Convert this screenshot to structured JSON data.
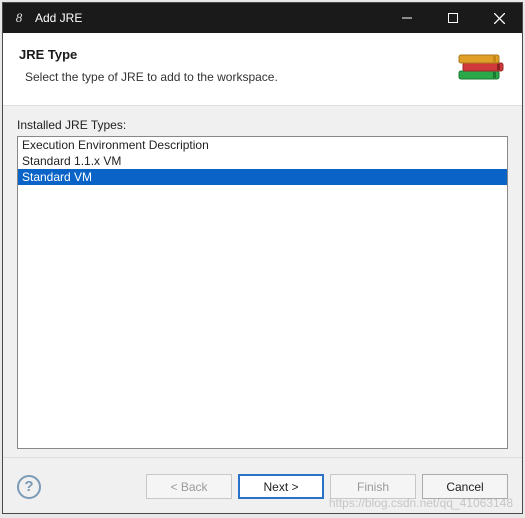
{
  "titlebar": {
    "icon_glyph": "8",
    "title": "Add JRE"
  },
  "header": {
    "title": "JRE Type",
    "subtitle": "Select the type of JRE to add to the workspace."
  },
  "list": {
    "label": "Installed JRE Types:",
    "items": [
      {
        "label": "Execution Environment Description",
        "selected": false
      },
      {
        "label": "Standard 1.1.x VM",
        "selected": false
      },
      {
        "label": "Standard VM",
        "selected": true
      }
    ]
  },
  "buttons": {
    "back": "< Back",
    "next": "Next >",
    "finish": "Finish",
    "cancel": "Cancel"
  },
  "watermark": "https://blog.csdn.net/qq_41063148"
}
